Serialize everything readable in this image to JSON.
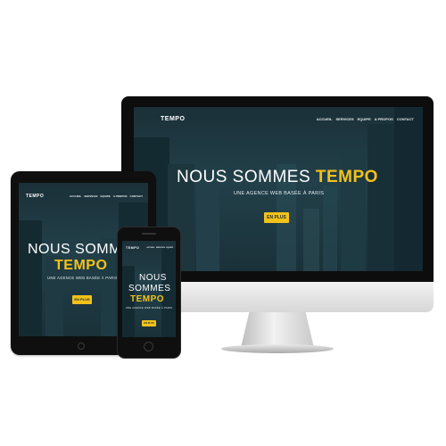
{
  "colors": {
    "accent": "#f2c21b",
    "hero_bg": "#1f3a43",
    "device_frame": "#111111"
  },
  "site": {
    "brand": "TEMPO",
    "nav": [
      "ACCUEIL",
      "SERVICES",
      "EQUIPE",
      "A PROPOS",
      "CONTACT"
    ],
    "hero_line1": "NOUS SOMMES",
    "hero_line2": "TEMPO",
    "phone_line1": "NOUS",
    "phone_line2": "SOMMES",
    "tagline": "UNE AGENCE WEB BASÉE À PARIS",
    "cta": "EN PLUS"
  }
}
